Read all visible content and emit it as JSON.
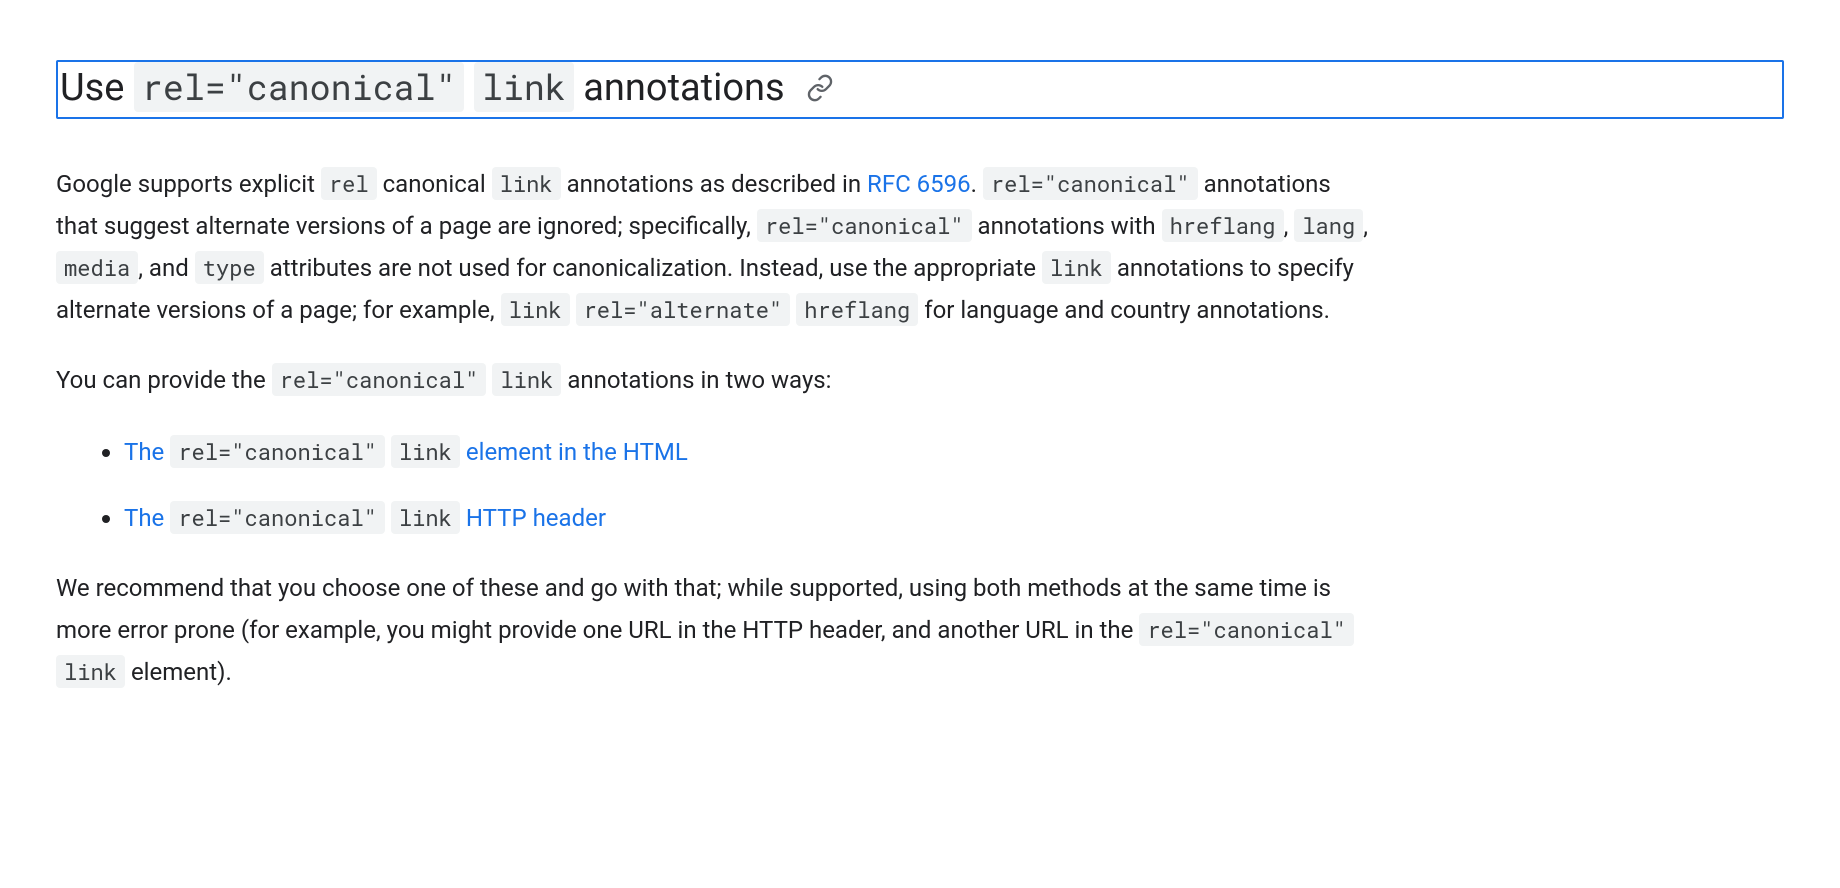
{
  "heading": {
    "t1": "Use ",
    "code1": "rel=\"canonical\"",
    "sp1": " ",
    "code2": "link",
    "t2": " annotations"
  },
  "para1": {
    "t1": "Google supports explicit ",
    "c_rel": "rel",
    "t2": " canonical ",
    "c_link": "link",
    "t3": " annotations as described in ",
    "rfc_link": "RFC 6596",
    "t4": ". ",
    "c_relcanon1": "rel=\"canonical\"",
    "t5": " annotations that suggest alternate versions of a page are ignored; specifically, ",
    "c_relcanon2": "rel=\"canonical\"",
    "t6": " annotations with ",
    "c_hreflang": "hreflang",
    "t7": ", ",
    "c_lang": "lang",
    "t8": ", ",
    "c_media": "media",
    "t9": ", and ",
    "c_type": "type",
    "t10": " attributes are not used for canonicalization. Instead, use the appropriate ",
    "c_link2": "link",
    "t11": " annotations to specify alternate versions of a page; for example, ",
    "c_link3": "link",
    "sp1": " ",
    "c_relalt": "rel=\"alternate\"",
    "sp2": " ",
    "hreflang_link_code": "hreflang",
    "t12": " for language and country annotations."
  },
  "para2": {
    "t1": "You can provide the ",
    "c_relcanon": "rel=\"canonical\"",
    "sp1": " ",
    "c_link": "link",
    "t2": " annotations in two ways:"
  },
  "list": {
    "item1": {
      "pre": "The ",
      "c_relcanon": "rel=\"canonical\"",
      "sp1": " ",
      "c_link": "link",
      "post": " element in the HTML"
    },
    "item2": {
      "pre": "The ",
      "c_relcanon": "rel=\"canonical\"",
      "sp1": " ",
      "c_link": "link",
      "post": " HTTP header"
    }
  },
  "para3": {
    "t1": "We recommend that you choose one of these and go with that; while supported, using both methods at the same time is more error prone (for example, you might provide one URL in the HTTP header, and another URL in the ",
    "c_relcanon": "rel=\"canonical\"",
    "sp1": " ",
    "c_link": "link",
    "t2": " element)."
  }
}
